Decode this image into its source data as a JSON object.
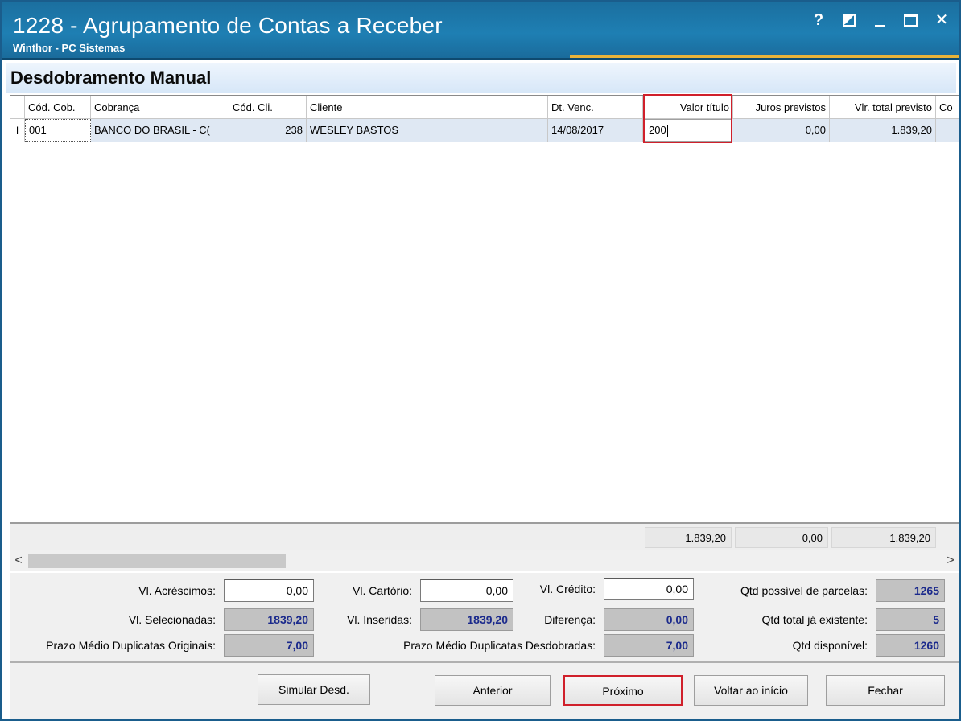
{
  "window": {
    "title": "1228 - Agrupamento de Contas a Receber",
    "subtitle": "Winthor - PC Sistemas",
    "controls": {
      "help": "?",
      "close": "✕"
    }
  },
  "section": {
    "title": "Desdobramento Manual"
  },
  "grid": {
    "columns": [
      "Cód. Cob.",
      "Cobrança",
      "Cód. Cli.",
      "Cliente",
      "Dt. Venc.",
      "Valor título",
      "Juros previstos",
      "Vlr. total previsto",
      "Co"
    ],
    "rows": [
      {
        "indicator": "I",
        "cod_cob": "001",
        "cobranca": "BANCO DO BRASIL - C(",
        "cod_cli": "238",
        "cliente": "WESLEY BASTOS",
        "dt_venc": "14/08/2017",
        "valor_titulo": "200",
        "juros_previstos": "0,00",
        "vlr_total_previsto": "1.839,20"
      }
    ],
    "totals": {
      "valor_titulo": "1.839,20",
      "juros_previstos": "0,00",
      "vlr_total_previsto": "1.839,20"
    },
    "scroll": {
      "left": "<",
      "right": ">"
    }
  },
  "summary": {
    "vl_acrescimos_label": "Vl. Acréscimos:",
    "vl_acrescimos": "0,00",
    "vl_cartorio_label": "Vl. Cartório:",
    "vl_cartorio": "0,00",
    "vl_credito_label": "Vl. Crédito:",
    "vl_credito": "0,00",
    "qtd_possivel_label": "Qtd possível de parcelas:",
    "qtd_possivel": "1265",
    "vl_selecionadas_label": "Vl. Selecionadas:",
    "vl_selecionadas": "1839,20",
    "vl_inseridas_label": "Vl. Inseridas:",
    "vl_inseridas": "1839,20",
    "diferenca_label": "Diferença:",
    "diferenca": "0,00",
    "qtd_total_label": "Qtd total já existente:",
    "qtd_total": "5",
    "prazo_originais_label": "Prazo Médio Duplicatas Originais:",
    "prazo_originais": "7,00",
    "prazo_desdobradas_label": "Prazo Médio Duplicatas Desdobradas:",
    "prazo_desdobradas": "7,00",
    "qtd_disponivel_label": "Qtd disponível:",
    "qtd_disponivel": "1260"
  },
  "buttons": {
    "simular": "Simular Desd.",
    "anterior": "Anterior",
    "proximo": "Próximo",
    "voltar": "Voltar ao início",
    "fechar": "Fechar"
  },
  "colors": {
    "titlebar": "#1e7fb3",
    "accent": "#e8b33a",
    "highlight": "#d0202b",
    "readonly_text": "#1b2a8c"
  }
}
